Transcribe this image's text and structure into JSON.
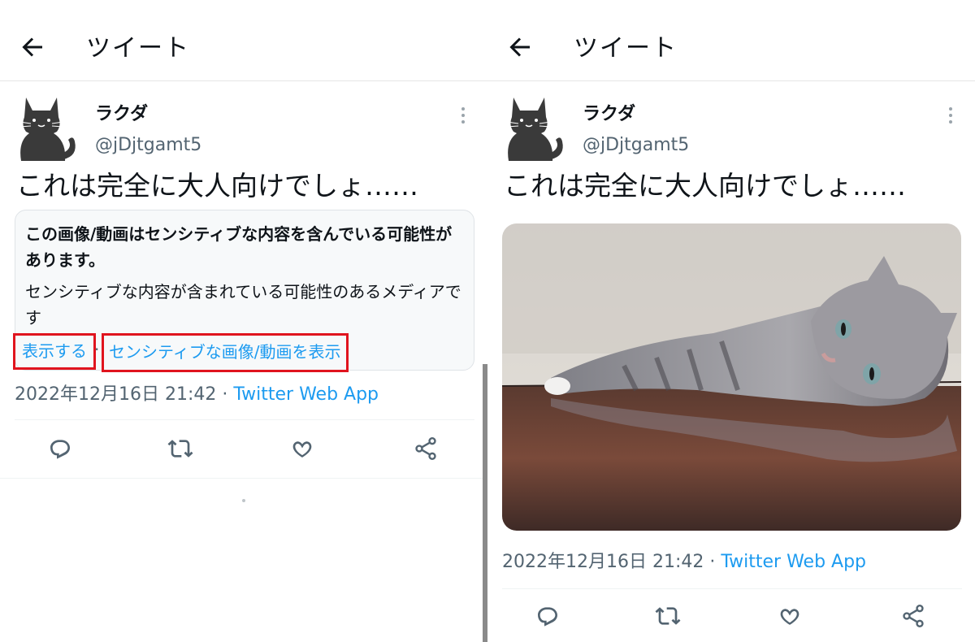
{
  "left": {
    "header": {
      "title": "ツイート"
    },
    "user": {
      "name": "ラクダ",
      "handle": "@jDjtgamt5"
    },
    "tweet": {
      "text": "これは完全に大人向けでしょ……"
    },
    "warning": {
      "title": "この画像/動画はセンシティブな内容を含んでいる可能性があります。",
      "description": "センシティブな内容が含まれている可能性のあるメディアです",
      "show_label": "表示する",
      "separator": "·",
      "show_sensitive_label": "センシティブな画像/動画を表示"
    },
    "meta": {
      "date": "2022年12月16日 21:42 · ",
      "app": "Twitter Web App"
    }
  },
  "right": {
    "header": {
      "title": "ツイート"
    },
    "user": {
      "name": "ラクダ",
      "handle": "@jDjtgamt5"
    },
    "tweet": {
      "text": "これは完全に大人向けでしょ……"
    },
    "meta": {
      "date": "2022年12月16日 21:42 · ",
      "app": "Twitter Web App"
    }
  },
  "colors": {
    "link_blue": "#1d9bf0",
    "highlight_red": "#e0141e",
    "secondary_text": "#536471"
  },
  "icons": [
    "back-arrow-icon",
    "more-vertical-icon",
    "reply-icon",
    "retweet-icon",
    "like-icon",
    "share-icon"
  ]
}
